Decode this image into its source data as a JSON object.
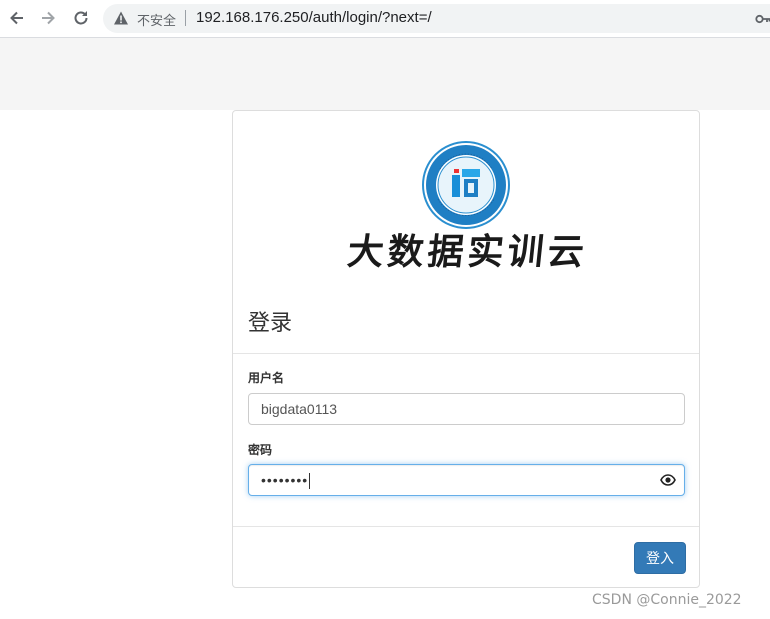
{
  "browser": {
    "security_label": "不安全",
    "url": "192.168.176.250/auth/login/?next=/",
    "icons": [
      "back-icon",
      "forward-icon",
      "reload-icon",
      "warning-icon",
      "key-icon"
    ]
  },
  "login": {
    "app_title": "大数据实训云",
    "heading": "登录",
    "username_label": "用户名",
    "username_value": "bigdata0113",
    "password_label": "密码",
    "password_mask": "••••••••",
    "submit_label": "登入"
  },
  "watermark": "CSDN @Connie_2022",
  "colors": {
    "primary": "#337ab7",
    "focus_border": "#66afe9",
    "emblem_ring": "#2a8fd0"
  }
}
